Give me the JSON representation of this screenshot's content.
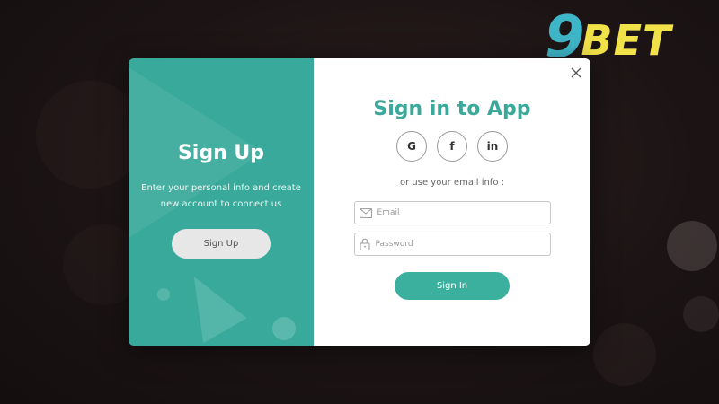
{
  "brand": {
    "logo_number": "9",
    "logo_text": "BET"
  },
  "left_panel": {
    "title": "Sign Up",
    "description": "Enter your personal info and create new account to connect us",
    "button_label": "Sign Up"
  },
  "right_panel": {
    "title": "Sign in to App",
    "social_buttons": [
      {
        "label": "G",
        "icon": "google-icon"
      },
      {
        "label": "f",
        "icon": "facebook-icon"
      },
      {
        "label": "in",
        "icon": "linkedin-icon"
      }
    ],
    "divider_text": "or use your email info :",
    "email": {
      "value": "",
      "placeholder": "Email",
      "icon": "mail-icon"
    },
    "password": {
      "value": "",
      "placeholder": "Password",
      "icon": "lock-icon"
    },
    "submit_label": "Sign In",
    "close_icon": "close-icon"
  },
  "colors": {
    "teal_panel": "#38a99b",
    "teal_title": "#3aa99a",
    "sign_in_button": "#3bb09e",
    "logo_nine": "#3fb6c8",
    "logo_bet": "#f2e24a"
  }
}
